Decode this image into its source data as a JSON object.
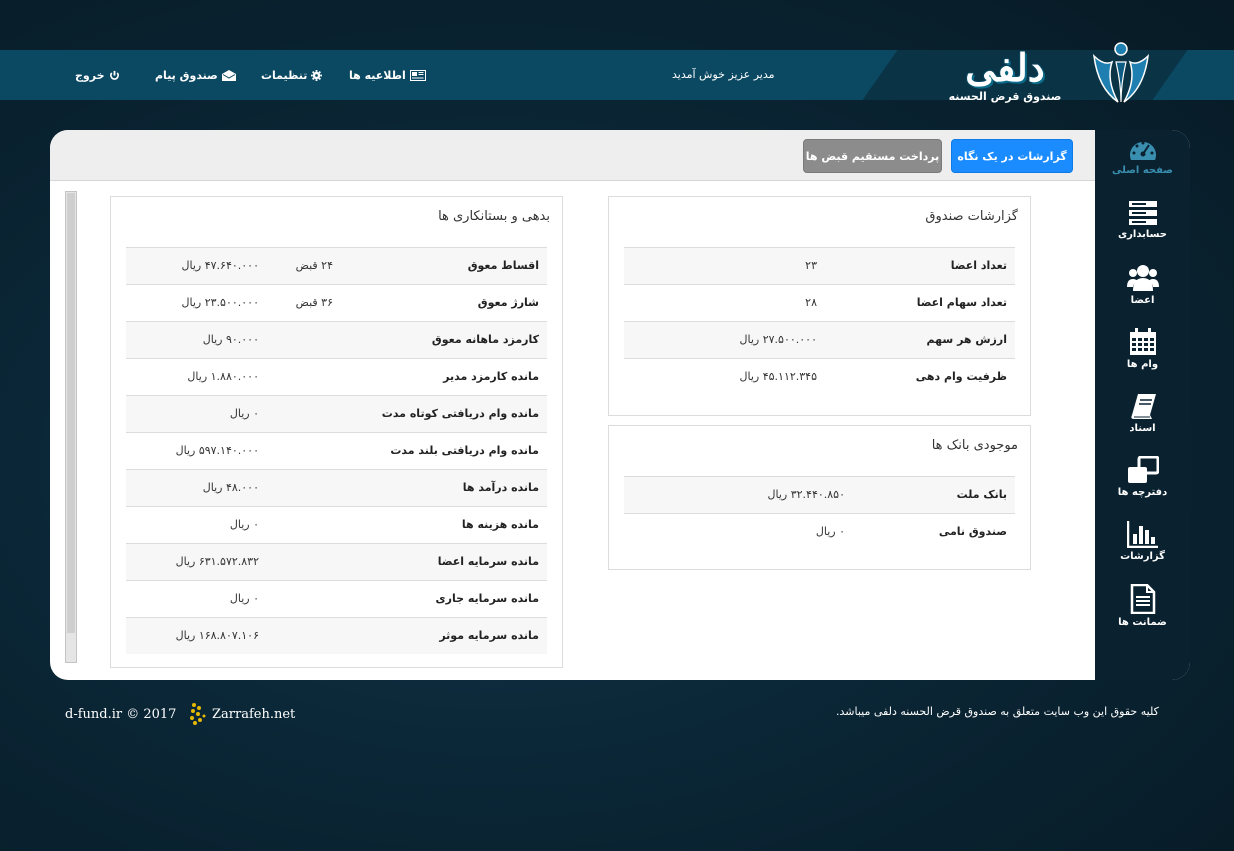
{
  "header": {
    "welcome": "مدیر عزیز خوش آمدید",
    "nav": [
      {
        "label": "خروج",
        "icon": "power-icon"
      },
      {
        "label": "صندوق پیام",
        "icon": "envelope-icon"
      },
      {
        "label": "تنظیمات",
        "icon": "gear-icon"
      },
      {
        "label": "اطلاعیه ها",
        "icon": "newspaper-icon"
      }
    ],
    "logo_title": "دلفی",
    "logo_subtitle": "صندوق قرض الحسنه"
  },
  "toolbar": {
    "primary_button": "گزارشات در یک نگاه",
    "secondary_button": "پرداخت مستقیم قبض ها"
  },
  "fund_report": {
    "title": "گزارشات صندوق",
    "rows": [
      {
        "label": "تعداد اعضا",
        "value": "۲۳"
      },
      {
        "label": "تعداد سهام اعضا",
        "value": "۲۸"
      },
      {
        "label": "ارزش هر سهم",
        "value": "۲۷.۵۰۰.۰۰۰ ریال"
      },
      {
        "label": "ظرفیت وام دهی",
        "value": "۴۵.۱۱۲.۳۴۵ ریال"
      }
    ]
  },
  "bank_balance": {
    "title": "موجودی بانک ها",
    "rows": [
      {
        "label": "بانک ملت",
        "value": "۳۲.۴۴۰.۸۵۰ ریال"
      },
      {
        "label": "صندوق نامی",
        "value": "۰ ریال"
      }
    ]
  },
  "debts": {
    "title": "بدهی و بستانکاری ها",
    "rows": [
      {
        "label": "اقساط معوق",
        "qty": "۲۴ قبض",
        "value": "۴۷.۶۴۰.۰۰۰ ریال"
      },
      {
        "label": "شارژ معوق",
        "qty": "۳۶ قبض",
        "value": "۲۳.۵۰۰.۰۰۰ ریال"
      },
      {
        "label": "کارمزد ماهانه معوق",
        "qty": "",
        "value": "۹۰.۰۰۰ ریال"
      },
      {
        "label": "مانده کارمزد مدیر",
        "qty": "",
        "value": "۱.۸۸۰.۰۰۰ ریال"
      },
      {
        "label": "مانده وام دریافتی کوتاه مدت",
        "qty": "",
        "value": "۰ ریال"
      },
      {
        "label": "مانده وام دریافتی بلند مدت",
        "qty": "",
        "value": "۵۹۷.۱۴۰.۰۰۰ ریال"
      },
      {
        "label": "مانده درآمد ها",
        "qty": "",
        "value": "۴۸.۰۰۰ ریال"
      },
      {
        "label": "مانده هزینه ها",
        "qty": "",
        "value": "۰ ریال"
      },
      {
        "label": "مانده سرمایه اعضا",
        "qty": "",
        "value": "۶۳۱.۵۷۲.۸۳۲ ریال"
      },
      {
        "label": "مانده سرمایه جاری",
        "qty": "",
        "value": "۰ ریال"
      },
      {
        "label": "مانده سرمایه موثر",
        "qty": "",
        "value": "۱۶۸.۸۰۷.۱۰۶ ریال"
      }
    ]
  },
  "sidebar": {
    "items": [
      {
        "label": "صفحه اصلی",
        "icon": "dashboard-icon"
      },
      {
        "label": "حسابداری",
        "icon": "server-icon"
      },
      {
        "label": "اعضا",
        "icon": "users-icon"
      },
      {
        "label": "وام ها",
        "icon": "calendar-icon"
      },
      {
        "label": "اسناد",
        "icon": "book-icon"
      },
      {
        "label": "دفترچه ها",
        "icon": "clone-icon"
      },
      {
        "label": "گزارشات",
        "icon": "bar-chart-icon"
      },
      {
        "label": "ضمانت ها",
        "icon": "file-text-icon"
      }
    ]
  },
  "footer": {
    "rights": "کلیه حقوق این وب سایت متعلق به صندوق قرض الحسنه دلفی میباشد.",
    "copyright": "d-fund.ir © 2017",
    "brand": "Zarrafeh.net"
  },
  "colors": {
    "topbar": "#0b4963",
    "primary": "#1a8cff",
    "sidebar": "#0a2230",
    "active": "#3a8fb0"
  }
}
